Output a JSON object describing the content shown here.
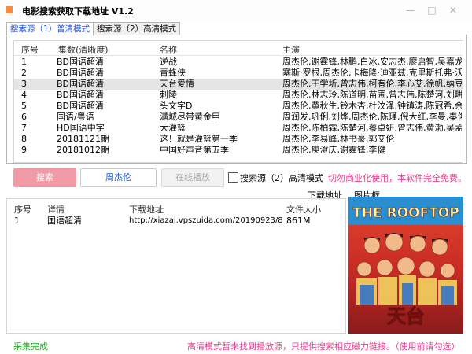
{
  "window": {
    "title": "电影搜索获取下载地址 V1.2",
    "minimize_glyph": "—",
    "maximize_glyph": "□",
    "close_glyph": "✕",
    "accent": "#1e4fe0"
  },
  "tabs": [
    {
      "label": "搜索源（1）普清模式",
      "active": true
    },
    {
      "label": "搜索源（2）高清模式",
      "active": false
    }
  ],
  "results_table": {
    "columns": [
      "序号",
      "集数(清晰度)",
      "名称",
      "主演"
    ],
    "rows": [
      {
        "no": "1",
        "quality": "BD国语超清",
        "name": "逆战",
        "cast": "周杰伦,谢霆锋,林鹏,白冰,安志杰,廖启智,吴嘉龙,..."
      },
      {
        "no": "2",
        "quality": "BD国语超清",
        "name": "青蜂侠",
        "cast": "塞斯·罗根,周杰伦,卡梅隆·迪亚兹,克里斯托弗·沃尔..."
      },
      {
        "no": "3",
        "quality": "BD国语超清",
        "name": "天台爱情",
        "cast": "周杰伦,王学圻,曾志伟,柯有伦,李心艾,徐帆,纳豆,..."
      },
      {
        "no": "4",
        "quality": "BD国语超清",
        "name": "刺陵",
        "cast": "周杰伦,林志玲,陈道明,苗圃,曾志伟,陈楚河,刘畊宏..."
      },
      {
        "no": "5",
        "quality": "BD国语超清",
        "name": "头文字D",
        "cast": "周杰伦,黄秋生,铃木杏,杜汶泽,钟镇涛,陈冠希,余文..."
      },
      {
        "no": "6",
        "quality": "国语/粤语",
        "name": "满城尽带黄金甲",
        "cast": "周润发,巩俐,刘烨,周杰伦,陈瑾,倪大红,李曼,秦俊..."
      },
      {
        "no": "7",
        "quality": "HD国语中字",
        "name": "大灌篮",
        "cast": "周杰伦,陈柏霖,陈楚河,蔡卓妍,曾志伟,黄渤,吴孟达..."
      },
      {
        "no": "8",
        "quality": "20181121期",
        "name": "这！就是灌篮第一季",
        "cast": "周杰伦,李易峰,林书豪,郭艾伦"
      },
      {
        "no": "9",
        "quality": "20181012期",
        "name": "中国好声音第五季",
        "cast": "周杰伦,庾澄庆,谢霆锋,李健"
      }
    ],
    "selected_row": 2
  },
  "toolbar": {
    "search_label": "搜索",
    "keyword_value": "周杰伦",
    "online_play_label": "在线播放",
    "source2_checkbox_label": "搜索源（2）高清模式",
    "notice": "切勿商业化使用，本软件完全免费。"
  },
  "labels": {
    "download_address": "下载地址",
    "picture_frame": "图片框"
  },
  "download_table": {
    "columns": [
      "序号",
      "详情",
      "下载地址",
      "文件大小"
    ],
    "rows": [
      {
        "no": "1",
        "detail": "国语超清",
        "url": "http://xiazai.vpszuida.com/20190923/842_...",
        "size": "861M"
      }
    ]
  },
  "poster": {
    "title_text": "THE ROOFTOP",
    "subtitle_text": "天台",
    "bg_color": "#d9342b"
  },
  "status": {
    "left": "采集完成",
    "right": "高清模式暂未找到播放源，只提供搜索相应磁力链接。（使用前请勾选）"
  }
}
